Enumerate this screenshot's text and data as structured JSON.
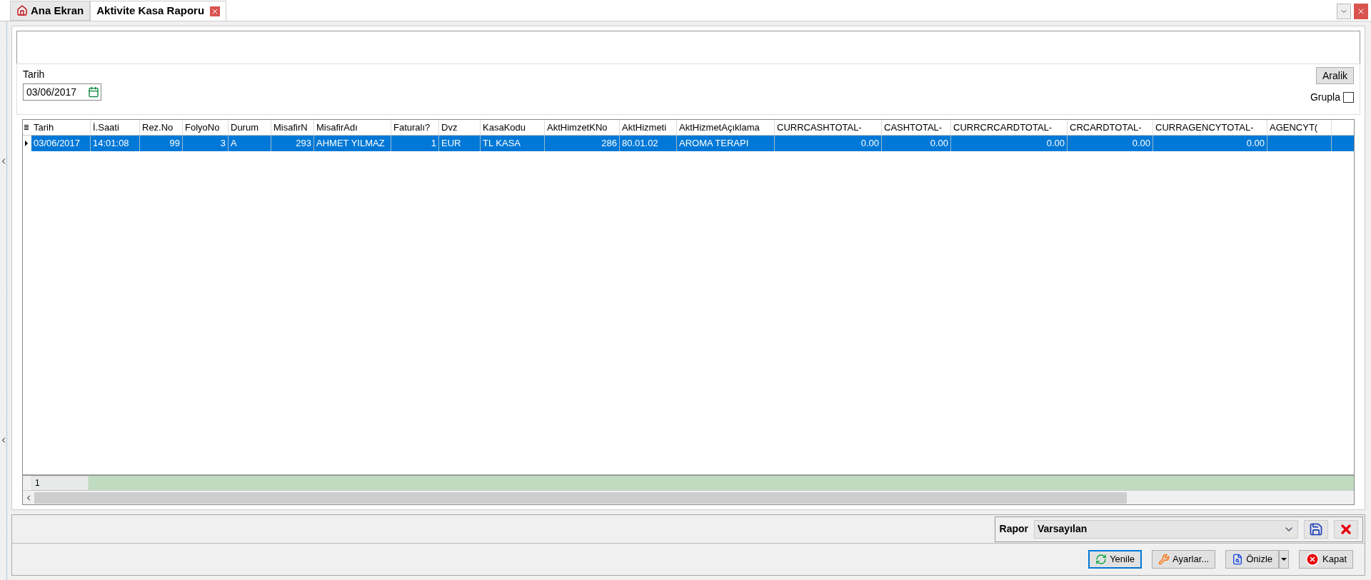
{
  "tabs": [
    {
      "label": "Ana Ekran",
      "selected": false,
      "kind": "home"
    },
    {
      "label": "Aktivite Kasa Raporu",
      "selected": true,
      "kind": "closable"
    }
  ],
  "filter": {
    "date_label": "Tarih",
    "date_value": "03/06/2017",
    "range_button": "Aralik",
    "group_label": "Grupla",
    "group_checked": false
  },
  "table": {
    "columns": [
      {
        "label": "Tarih",
        "kind": "text"
      },
      {
        "label": "İ.Saati",
        "kind": "text"
      },
      {
        "label": "Rez.No",
        "kind": "number"
      },
      {
        "label": "FolyoNo",
        "kind": "number"
      },
      {
        "label": "Durum",
        "kind": "text"
      },
      {
        "label": "MisafirN",
        "kind": "number"
      },
      {
        "label": "MisafirAdı",
        "kind": "text"
      },
      {
        "label": "Faturalı?",
        "kind": "number"
      },
      {
        "label": "Dvz",
        "kind": "text"
      },
      {
        "label": "KasaKodu",
        "kind": "text"
      },
      {
        "label": "AktHimzetKNo",
        "kind": "number"
      },
      {
        "label": "AktHizmeti",
        "kind": "text"
      },
      {
        "label": "AktHizmetAçıklama",
        "kind": "text"
      },
      {
        "label": "CURRCASHTOTAL-",
        "kind": "number"
      },
      {
        "label": "CASHTOTAL-",
        "kind": "number"
      },
      {
        "label": "CURRCRCARDTOTAL-",
        "kind": "number"
      },
      {
        "label": "CRCARDTOTAL-",
        "kind": "number"
      },
      {
        "label": "CURRAGENCYTOTAL-",
        "kind": "number"
      },
      {
        "label": "AGENCYT(",
        "kind": "number"
      }
    ],
    "rows": [
      {
        "selected": true,
        "cells": [
          "03/06/2017",
          "14:01:08",
          "99",
          "3",
          "A",
          "293",
          "AHMET YILMAZ",
          "1",
          "EUR",
          "TL KASA",
          "286",
          "80.01.02",
          "AROMA TERAPI",
          "0.00",
          "0.00",
          "0.00",
          "0.00",
          "0.00",
          null
        ]
      }
    ],
    "footer_count": "1"
  },
  "report": {
    "label": "Rapor",
    "value": "Varsayılan"
  },
  "buttons": [
    {
      "label": "Yenile",
      "kind": "refresh",
      "focused": true
    },
    {
      "label": "Ayarlar...",
      "kind": "settings",
      "focused": false
    },
    {
      "label": "Önizle",
      "kind": "preview",
      "focused": false
    },
    {
      "label": "Kapat",
      "kind": "close",
      "focused": false
    }
  ]
}
